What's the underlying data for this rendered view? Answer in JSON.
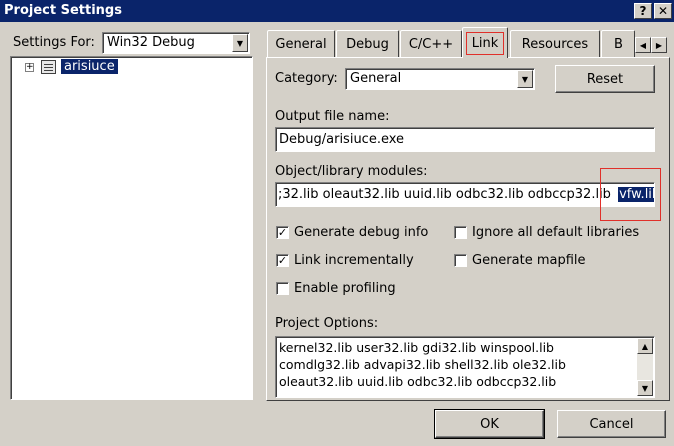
{
  "window": {
    "title": "Project Settings",
    "help_glyph": "?",
    "close_glyph": "✕"
  },
  "settings_for": {
    "label": "Settings For:",
    "value": "Win32 Debug"
  },
  "tree": {
    "expander": "+",
    "root_label": "arisiuce"
  },
  "tabs": [
    {
      "label": "General"
    },
    {
      "label": "Debug"
    },
    {
      "label": "C/C++"
    },
    {
      "label": "Link"
    },
    {
      "label": "Resources"
    },
    {
      "label": "B"
    }
  ],
  "tab_scroll": {
    "left": "◀",
    "right": "▶"
  },
  "category": {
    "label": "Category:",
    "value": "General",
    "reset_label": "Reset"
  },
  "output": {
    "label": "Output file name:",
    "value": "Debug/arisiuce.exe"
  },
  "objlib": {
    "label": "Object/library modules:",
    "value": ";32.lib oleaut32.lib uuid.lib odbc32.lib odbccp32.lib",
    "selected": "vfw.lib"
  },
  "checkboxes": {
    "debug_info": {
      "label": "Generate debug info",
      "checked": true
    },
    "ignore_libs": {
      "label": "Ignore all default libraries",
      "checked": false
    },
    "incremental": {
      "label": "Link incrementally",
      "checked": true
    },
    "mapfile": {
      "label": "Generate mapfile",
      "checked": false
    },
    "profiling": {
      "label": "Enable profiling",
      "checked": false
    }
  },
  "check_glyph": "✓",
  "options": {
    "label": "Project Options:",
    "lines": [
      "kernel32.lib user32.lib gdi32.lib winspool.lib",
      "comdlg32.lib advapi32.lib shell32.lib ole32.lib",
      "oleaut32.lib uuid.lib odbc32.lib odbccp32.lib"
    ]
  },
  "scroll": {
    "up": "▲",
    "down": "▼"
  },
  "buttons": {
    "ok": "OK",
    "cancel": "Cancel"
  },
  "colors": {
    "titlebar": "#0a246a",
    "face": "#d4d0c8",
    "highlight_box": "#e0302a"
  }
}
